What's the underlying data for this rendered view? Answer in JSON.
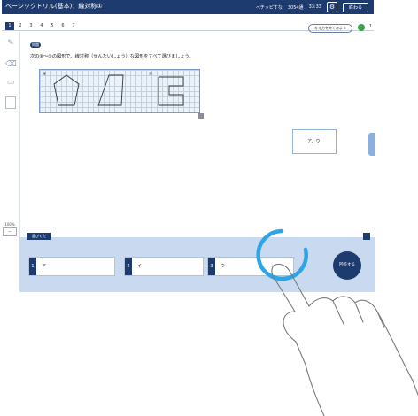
{
  "window": {
    "title": "ベーシックドリル(基本)：線対称①",
    "status_labels": [
      "ペチッピすな",
      "3054通",
      "33:33"
    ],
    "gear_icon": "gear-icon",
    "end_button": "終わる"
  },
  "tabs": [
    "1",
    "2",
    "3",
    "4",
    "5",
    "6",
    "7"
  ],
  "tabs_active_index": 0,
  "hint_pill": "考え方をみてみよう",
  "hint_count": "1",
  "sidebar": {
    "icons": [
      "pencil-icon",
      "eraser-icon",
      "card-icon",
      "document-icon"
    ],
    "zoom_label": "100%",
    "zoom_value": "ー"
  },
  "question": {
    "label": "問題",
    "text": "次の⑧～⑨の図形で、線対称（せんたいしょう）な図形をすべて選びましょう。",
    "shape_labels": [
      "⑧",
      "⑨"
    ]
  },
  "answer_card": {
    "text": "ア、ウ"
  },
  "answer_panel": {
    "label": "選びくだ",
    "fields": [
      {
        "tag": "1",
        "value": "ア"
      },
      {
        "tag": "2",
        "value": "イ"
      },
      {
        "tag": "3",
        "value": "ウ"
      }
    ],
    "separator": "・",
    "submit_label": "回答する"
  },
  "colors": {
    "accent": "#1d3b6e",
    "grid_line": "#bcd1ea",
    "panel_bg": "#c9d9ef",
    "touch_ring": "#2fa4e7",
    "hint_green": "#37a24a"
  }
}
